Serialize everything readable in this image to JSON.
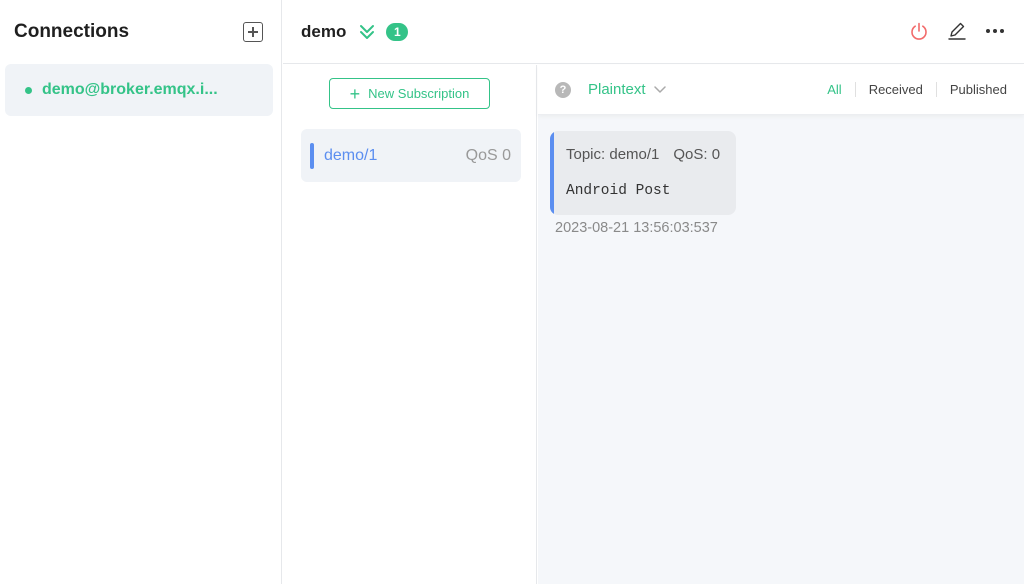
{
  "sidebar": {
    "title": "Connections",
    "connections": [
      {
        "name": "demo@broker.emqx.i...",
        "status": "connected"
      }
    ]
  },
  "topbar": {
    "title": "demo",
    "badge": "1"
  },
  "subscriptions": {
    "new_button_label": "New Subscription",
    "items": [
      {
        "topic": "demo/1",
        "qos": "QoS 0"
      }
    ]
  },
  "messages": {
    "help_icon": "?",
    "format": "Plaintext",
    "filters": [
      "All",
      "Received",
      "Published"
    ],
    "active_filter": "All",
    "items": [
      {
        "topic_label": "Topic: demo/1",
        "qos_label": "QoS: 0",
        "payload": "Android Post",
        "timestamp": "2023-08-21 13:56:03:537"
      }
    ]
  },
  "colors": {
    "accent": "#34c388",
    "topic_blue": "#5b8ef0",
    "disconnect_red": "#f26b6b"
  },
  "icons": {
    "add": "plus-square-icon",
    "collapse": "double-chevron-down-icon",
    "disconnect": "power-icon",
    "edit": "pencil-icon",
    "more": "more-horizontal-icon",
    "help": "question-circle-icon",
    "dropdown": "chevron-down-icon"
  }
}
